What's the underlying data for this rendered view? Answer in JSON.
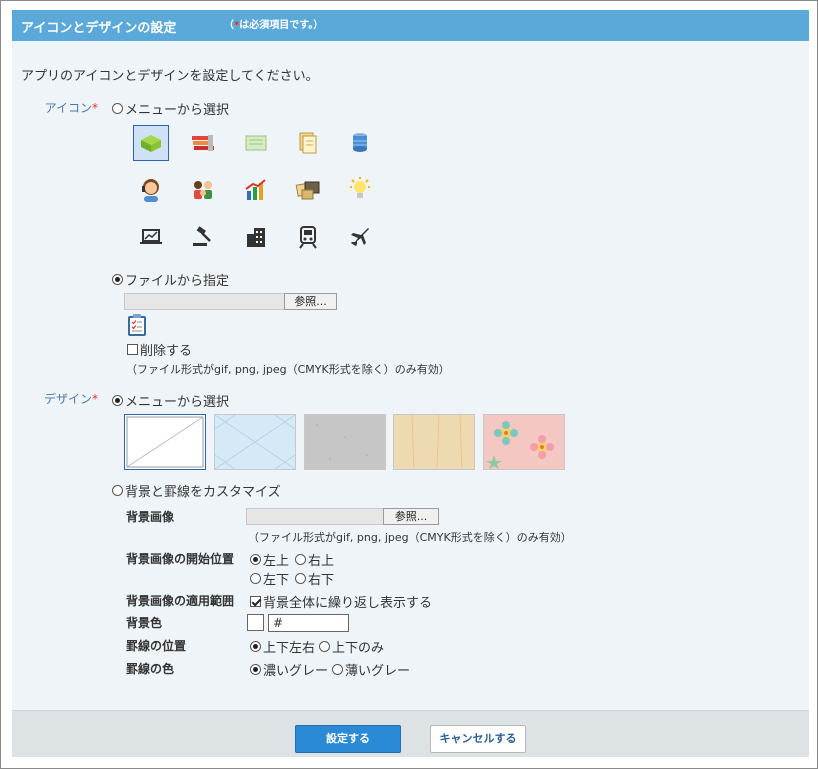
{
  "dialog": {
    "title": "アイコンとデザインの設定",
    "required_open": "（",
    "required_star": "*",
    "required_text": "は必須項目です。）"
  },
  "intro": "アプリのアイコンとデザインを設定してください。",
  "icon_section": {
    "label": "アイコン",
    "required": "*",
    "option_menu": "メニューから選択",
    "option_menu_selected": false,
    "icons": [
      {
        "name": "cube-icon",
        "selected": true
      },
      {
        "name": "books-icon",
        "selected": false
      },
      {
        "name": "cards-icon",
        "selected": false
      },
      {
        "name": "documents-icon",
        "selected": false
      },
      {
        "name": "database-icon",
        "selected": false
      },
      {
        "name": "operator-icon",
        "selected": false
      },
      {
        "name": "people-icon",
        "selected": false
      },
      {
        "name": "chart-icon",
        "selected": false
      },
      {
        "name": "photos-icon",
        "selected": false
      },
      {
        "name": "lightbulb-icon",
        "selected": false
      },
      {
        "name": "laptop-chart-icon",
        "selected": false
      },
      {
        "name": "gavel-icon",
        "selected": false
      },
      {
        "name": "building-icon",
        "selected": false
      },
      {
        "name": "train-icon",
        "selected": false
      },
      {
        "name": "airplane-icon",
        "selected": false
      }
    ],
    "option_file": "ファイルから指定",
    "option_file_selected": true,
    "browse_label": "参照...",
    "delete_label": "削除する",
    "delete_checked": false,
    "file_note": "（ファイル形式がgif, png, jpeg（CMYK形式を除く）のみ有効）"
  },
  "design_section": {
    "label": "デザイン",
    "required": "*",
    "option_menu": "メニューから選択",
    "option_menu_selected": true,
    "tiles": [
      {
        "name": "design-tile-white",
        "selected": true
      },
      {
        "name": "design-tile-blue",
        "selected": false
      },
      {
        "name": "design-tile-gray",
        "selected": false
      },
      {
        "name": "design-tile-wood",
        "selected": false
      },
      {
        "name": "design-tile-flower",
        "selected": false
      }
    ],
    "option_custom": "背景と罫線をカスタマイズ",
    "option_custom_selected": false,
    "bg_image_label": "背景画像",
    "bg_browse_label": "参照...",
    "bg_file_note": "（ファイル形式がgif, png, jpeg（CMYK形式を除く）のみ有効）",
    "start_pos_label": "背景画像の開始位置",
    "pos_top_left": "左上",
    "pos_top_right": "右上",
    "pos_bottom_left": "左下",
    "pos_bottom_right": "右下",
    "pos_selected": "左上",
    "apply_range_label": "背景画像の適用範囲",
    "repeat_label": "背景全体に繰り返し表示する",
    "repeat_checked": true,
    "bg_color_label": "背景色",
    "bg_color_value": "#",
    "border_pos_label": "罫線の位置",
    "border_all": "上下左右",
    "border_tb": "上下のみ",
    "border_pos_selected": "上下左右",
    "border_color_label": "罫線の色",
    "border_dark": "濃いグレー",
    "border_light": "薄いグレー",
    "border_color_selected": "濃いグレー"
  },
  "footer": {
    "save_label": "設定する",
    "cancel_label": "キャンセルする"
  },
  "colors": {
    "title_bar": "#5aa9d9",
    "panel_bg": "#eef4f8",
    "primary_button": "#2b8ad6",
    "required": "#e8332b",
    "label": "#4a79a8"
  }
}
